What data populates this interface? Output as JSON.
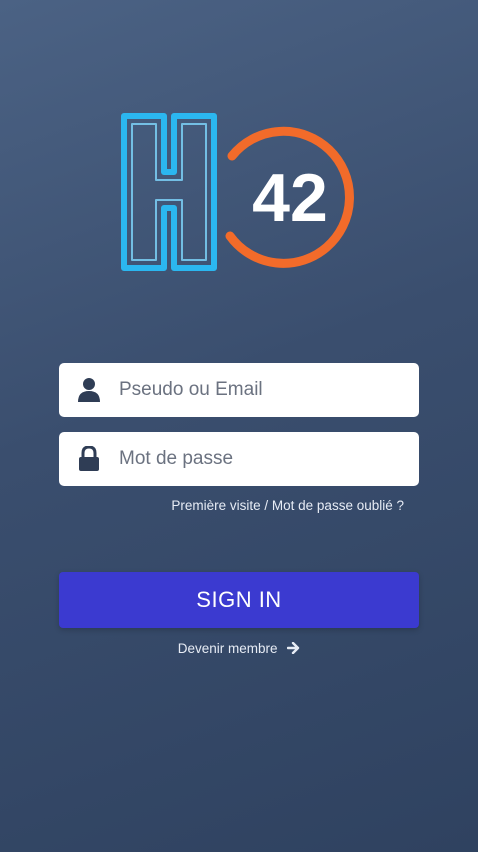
{
  "logo": {
    "letter": "H",
    "number": "42",
    "letter_color": "#2bb7f0",
    "ring_color": "#f26b2a"
  },
  "login": {
    "username_placeholder": "Pseudo ou Email",
    "password_placeholder": "Mot de passe",
    "forgot_link": "Première visite / Mot de passe oublié ?",
    "sign_in_label": "SIGN IN",
    "become_member": "Devenir membre"
  },
  "colors": {
    "background_top": "#4b6284",
    "background_bottom": "#2f4260",
    "button": "#3b3ad0",
    "icon": "#2f3d55"
  },
  "icons": [
    "user-icon",
    "lock-icon",
    "arrow-right-icon"
  ]
}
